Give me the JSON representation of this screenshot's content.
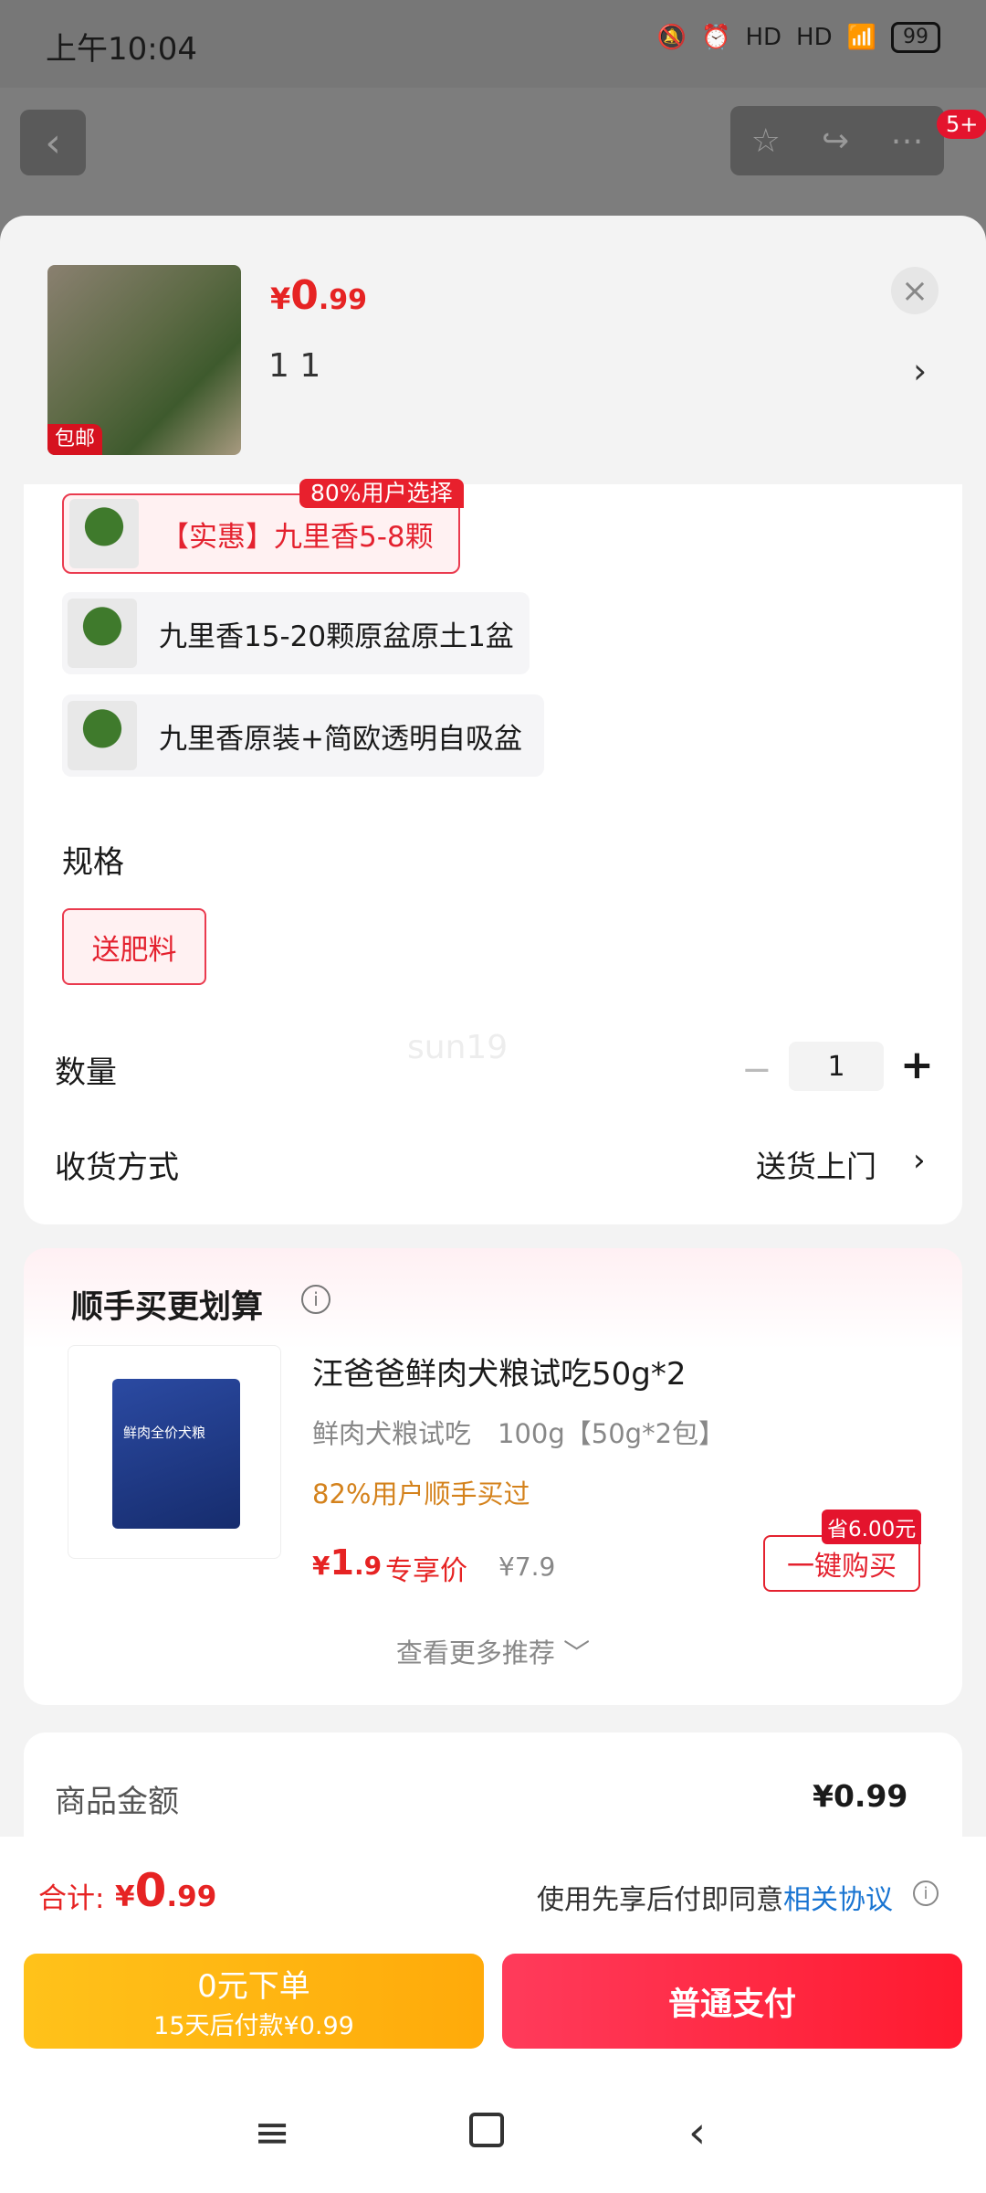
{
  "status_bar": {
    "time": "上午10:04",
    "signal_1": "HD",
    "signal_2": "HD",
    "battery": "99"
  },
  "header": {
    "notification_badge": "5+"
  },
  "product": {
    "thumb_tag": "包邮",
    "price": {
      "currency": "¥",
      "integer": "0",
      "decimal": ".99"
    },
    "selected_text": "1 1"
  },
  "options": [
    {
      "label": "【实惠】九里香5-8颗",
      "tag": "80%用户选择",
      "selected": true
    },
    {
      "label": "九里香15-20颗原盆原土1盆",
      "selected": false
    },
    {
      "label": "九里香原装+简欧透明自吸盆",
      "selected": false
    }
  ],
  "spec": {
    "title": "规格",
    "chip": "送肥料"
  },
  "quantity": {
    "label": "数量",
    "minus": "−",
    "value": "1",
    "plus": "+"
  },
  "delivery": {
    "label": "收货方式",
    "value": "送货上门"
  },
  "watermark": "sun19",
  "upsell": {
    "title": "顺手买更划算",
    "product_name": "汪爸爸鲜肉犬粮试吃50g*2",
    "spec": "鲜肉犬粮试吃　100g【50g*2包】",
    "percent": "82%用户顺手买过",
    "price": {
      "currency": "¥",
      "integer": "1",
      "decimal": ".9"
    },
    "exclusive": "专享价",
    "original": "¥7.9",
    "save_badge": "省6.00元",
    "buy_button": "一键购买",
    "bag_text": "鲜肉全价犬粮",
    "more": "查看更多推荐 ﹀"
  },
  "summary": {
    "label": "商品金额",
    "value": "¥0.99"
  },
  "footer": {
    "total_label": "合计:",
    "total": {
      "currency": "¥",
      "integer": "0",
      "decimal": ".99"
    },
    "agree_text": "使用先享后付即同意",
    "agree_link": "相关协议",
    "bnpl_line1": "0元下单",
    "bnpl_line2": "15天后付款¥0.99",
    "pay_button": "普通支付"
  },
  "colors": {
    "accent": "#e62323",
    "brand_yellow": "#ffb414",
    "link": "#1a75d2"
  }
}
